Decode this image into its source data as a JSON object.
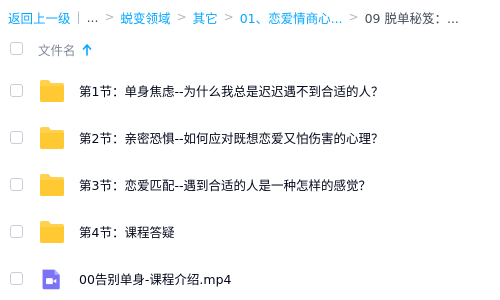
{
  "breadcrumb": {
    "back_label": "返回上一级",
    "ellipsis": "...",
    "items": [
      "蜕变领域",
      "其它",
      "01、恋爱情商心..."
    ],
    "current": "09 脱单秘笈：..."
  },
  "header": {
    "column_name": "文件名"
  },
  "files": [
    {
      "name": "第1节：单身焦虑--为什么我总是迟迟遇不到合适的人？",
      "icon": "folder-icon"
    },
    {
      "name": "第2节：亲密恐惧--如何应对既想恋爱又怕伤害的心理？",
      "icon": "folder-icon"
    },
    {
      "name": "第3节：恋爱匹配--遇到合适的人是一种怎样的感觉？",
      "icon": "folder-icon"
    },
    {
      "name": "第4节：课程答疑",
      "icon": "folder-icon"
    },
    {
      "name": "00告别单身-课程介绍.mp4",
      "icon": "video-file-icon"
    }
  ],
  "colors": {
    "link": "#06a7ff",
    "folder": "#ffd24d",
    "video": "#7b73f5"
  }
}
